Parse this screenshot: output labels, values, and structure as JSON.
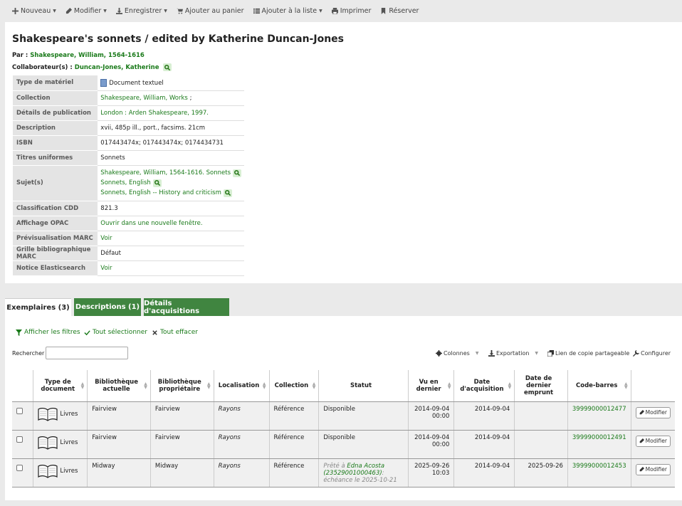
{
  "toolbar": {
    "new_label": "Nouveau",
    "edit_label": "Modifier",
    "save_label": "Enregistrer",
    "cart_label": "Ajouter au panier",
    "list_label": "Ajouter à la liste",
    "print_label": "Imprimer",
    "reserve_label": "Réserver"
  },
  "record": {
    "title": "Shakespeare's sonnets / edited by Katherine Duncan-Jones",
    "by_label": "Par :",
    "author": "Shakespeare, William, 1564-1616",
    "contrib_label": "Collaborateur(s) :",
    "contributor": "Duncan-Jones, Katherine",
    "details": {
      "material_label": "Type de matériel",
      "material_value": "Document textuel",
      "collection_label": "Collection",
      "collection_value": "Shakespeare, William, Works",
      "collection_suffix": ";",
      "pub_label": "Détails de publication",
      "pub_value": "London : Arden Shakespeare, 1997.",
      "desc_label": "Description",
      "desc_value": "xvii, 485p ill., port., facsims. 21cm",
      "isbn_label": "ISBN",
      "isbn_value": "017443474x; 017443474x; 0174434731",
      "uniform_label": "Titres uniformes",
      "uniform_value": "Sonnets",
      "subjects_label": "Sujet(s)",
      "subjects": [
        "Shakespeare, William, 1564-1616. Sonnets",
        "Sonnets, English",
        "Sonnets, English -- History and criticism"
      ],
      "dewey_label": "Classification CDD",
      "dewey_value": "821.3",
      "opac_label": "Affichage OPAC",
      "opac_value": "Ouvrir dans une nouvelle fenêtre.",
      "marc_preview_label": "Prévisualisation MARC",
      "marc_preview_value": "Voir",
      "marc_framework_label": "Grille bibliographique MARC",
      "marc_framework_value": "Défaut",
      "es_label": "Notice Elasticsearch",
      "es_value": "Voir"
    }
  },
  "tabs": {
    "items": "Exemplaires (3)",
    "descriptions": "Descriptions (1)",
    "acquisitions": "Détails d'acquisitions"
  },
  "items_toolbar": {
    "show_filters": "Afficher les filtres",
    "select_all": "Tout sélectionner",
    "clear_all": "Tout effacer",
    "search_label": "Rechercher :",
    "columns": "Colonnes",
    "export": "Exportation",
    "share_link": "Lien de copie partageable",
    "configure": "Configurer"
  },
  "columns": {
    "doc_type": "Type de document",
    "current_lib": "Bibliothèque actuelle",
    "home_lib": "Bibliothèque propriétaire",
    "location": "Localisation",
    "collection": "Collection",
    "status": "Statut",
    "last_seen": "Vu en dernier",
    "acq_date": "Date d'acquisition",
    "last_borrowed": "Date de dernier emprunt",
    "barcode": "Code-barres"
  },
  "rows": [
    {
      "doc_type": "Livres",
      "current_lib": "Fairview",
      "home_lib": "Fairview",
      "location": "Rayons",
      "collection": "Référence",
      "status": "Disponible",
      "last_seen_date": "2014-09-04",
      "last_seen_time": "00:00",
      "acq_date": "2014-09-04",
      "last_borrowed": "",
      "barcode": "39999000012477",
      "edit": "Modifier"
    },
    {
      "doc_type": "Livres",
      "current_lib": "Fairview",
      "home_lib": "Fairview",
      "location": "Rayons",
      "collection": "Référence",
      "status": "Disponible",
      "last_seen_date": "2014-09-04",
      "last_seen_time": "00:00",
      "acq_date": "2014-09-04",
      "last_borrowed": "",
      "barcode": "39999000012491",
      "edit": "Modifier"
    },
    {
      "doc_type": "Livres",
      "current_lib": "Midway",
      "home_lib": "Midway",
      "location": "Rayons",
      "collection": "Référence",
      "status_prefix": "Prêté à",
      "status_patron": "Edna Acosta",
      "status_patron_card": "(23529001000463)",
      "status_suffix": ":",
      "status_due": "échéance le 2025-10-21",
      "last_seen_date": "2025-09-26",
      "last_seen_time": "10:03",
      "acq_date": "2014-09-04",
      "last_borrowed": "2025-09-26",
      "barcode": "39999000012453",
      "edit": "Modifier"
    }
  ],
  "colors": {
    "link": "#1a7a1a",
    "tab_green": "#408540",
    "header_gray": "#e4e4e4",
    "background": "#eaeaea"
  }
}
